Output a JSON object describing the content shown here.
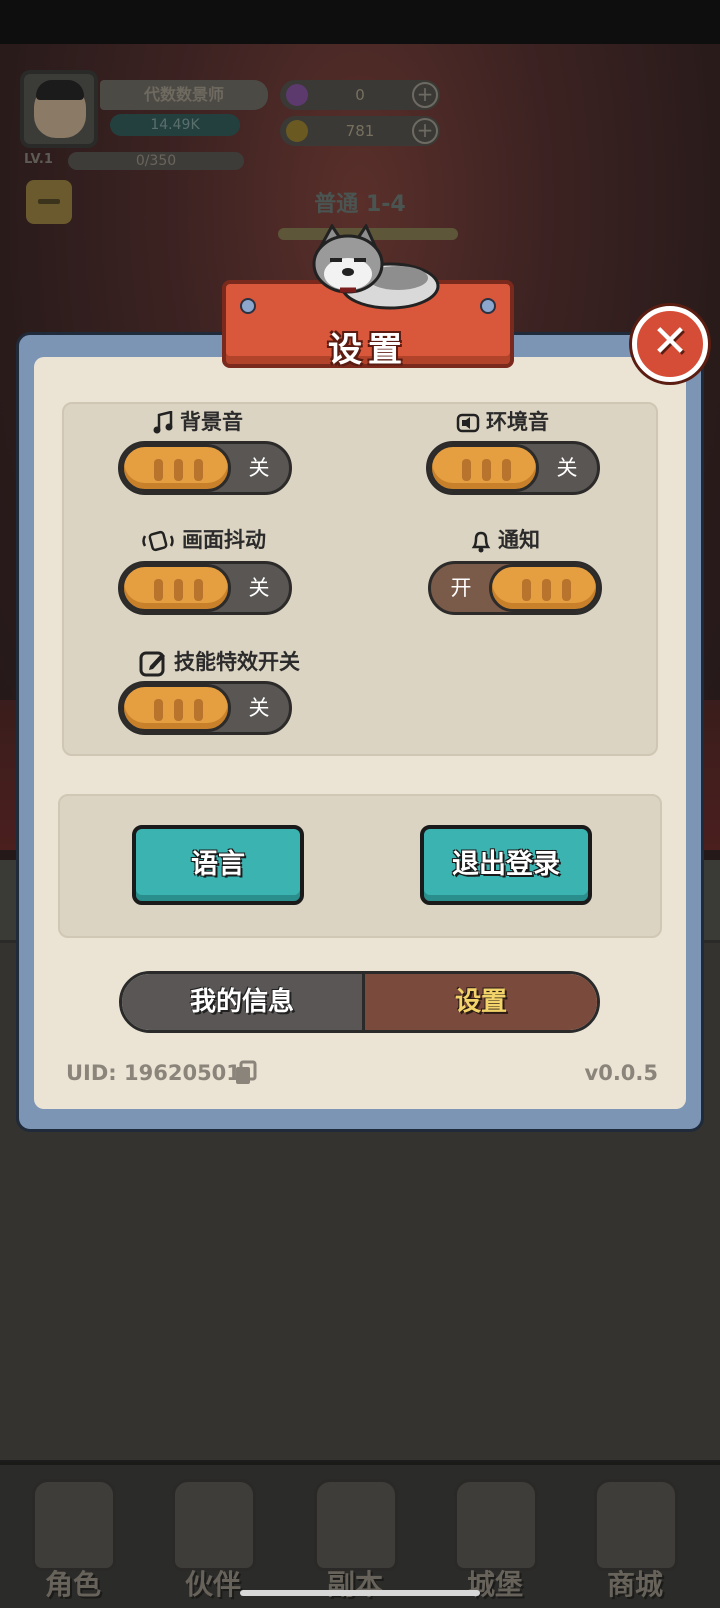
{
  "header": {
    "player_name": "代数数景师",
    "power": "14.49K",
    "level": "LV.1",
    "exp": "0/350",
    "gems": "0",
    "coins": "781",
    "stage": "普通 1-4"
  },
  "dialog": {
    "title": "设置",
    "close_label": "✕",
    "options": [
      {
        "label": "背景音",
        "icon": "music-note-icon",
        "state": "关",
        "on": false
      },
      {
        "label": "环境音",
        "icon": "speaker-icon",
        "state": "关",
        "on": false
      },
      {
        "label": "画面抖动",
        "icon": "vibrate-icon",
        "state": "关",
        "on": false
      },
      {
        "label": "通知",
        "icon": "bell-icon",
        "state": "开",
        "on": true
      },
      {
        "label": "技能特效开关",
        "icon": "edit-icon",
        "state": "关",
        "on": false
      }
    ],
    "buttons": {
      "language": "语言",
      "logout": "退出登录"
    },
    "tabs": {
      "my_info": "我的信息",
      "settings": "设置"
    },
    "uid": "UID: 19620501",
    "version": "v0.0.5"
  },
  "bottom_nav": [
    {
      "label": "角色",
      "icon": "character-icon"
    },
    {
      "label": "伙伴",
      "icon": "partner-icon"
    },
    {
      "label": "副本",
      "icon": "dungeon-icon"
    },
    {
      "label": "城堡",
      "icon": "castle-icon"
    },
    {
      "label": "商城",
      "icon": "shop-icon"
    }
  ],
  "colors": {
    "panel_frame": "#7d95b5",
    "panel_inner": "#ebe4d5",
    "banner": "#d9573a",
    "toggle_knob": "#e59f40",
    "teal_button": "#3bb4b1",
    "active_tab": "#7a4a3c",
    "active_tab_text": "#f3d46a"
  }
}
